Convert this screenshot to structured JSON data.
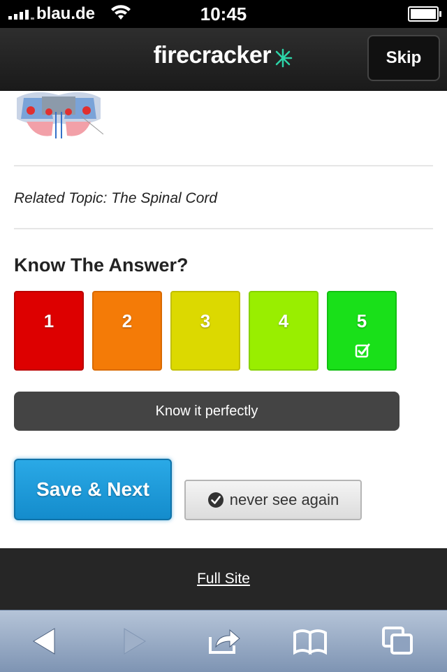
{
  "status_bar": {
    "carrier": "blau.de",
    "time": "10:45"
  },
  "header": {
    "logo_text": "firecracker",
    "skip_label": "Skip"
  },
  "content": {
    "related_topic": "Related Topic: The Spinal Cord",
    "question": "Know The Answer?",
    "ratings": [
      {
        "label": "1",
        "color": "#dd0000"
      },
      {
        "label": "2",
        "color": "#f47b07"
      },
      {
        "label": "3",
        "color": "#dcd900"
      },
      {
        "label": "4",
        "color": "#99ee00"
      },
      {
        "label": "5",
        "color": "#19e019",
        "selected": true
      }
    ],
    "rating_feedback": "Know it perfectly",
    "save_label": "Save & Next",
    "never_label": "never see again"
  },
  "footer": {
    "full_site_label": "Full Site"
  },
  "toolbar": {
    "icons": [
      "back-arrow-icon",
      "forward-arrow-icon",
      "share-icon",
      "bookmarks-icon",
      "tabs-icon"
    ]
  }
}
